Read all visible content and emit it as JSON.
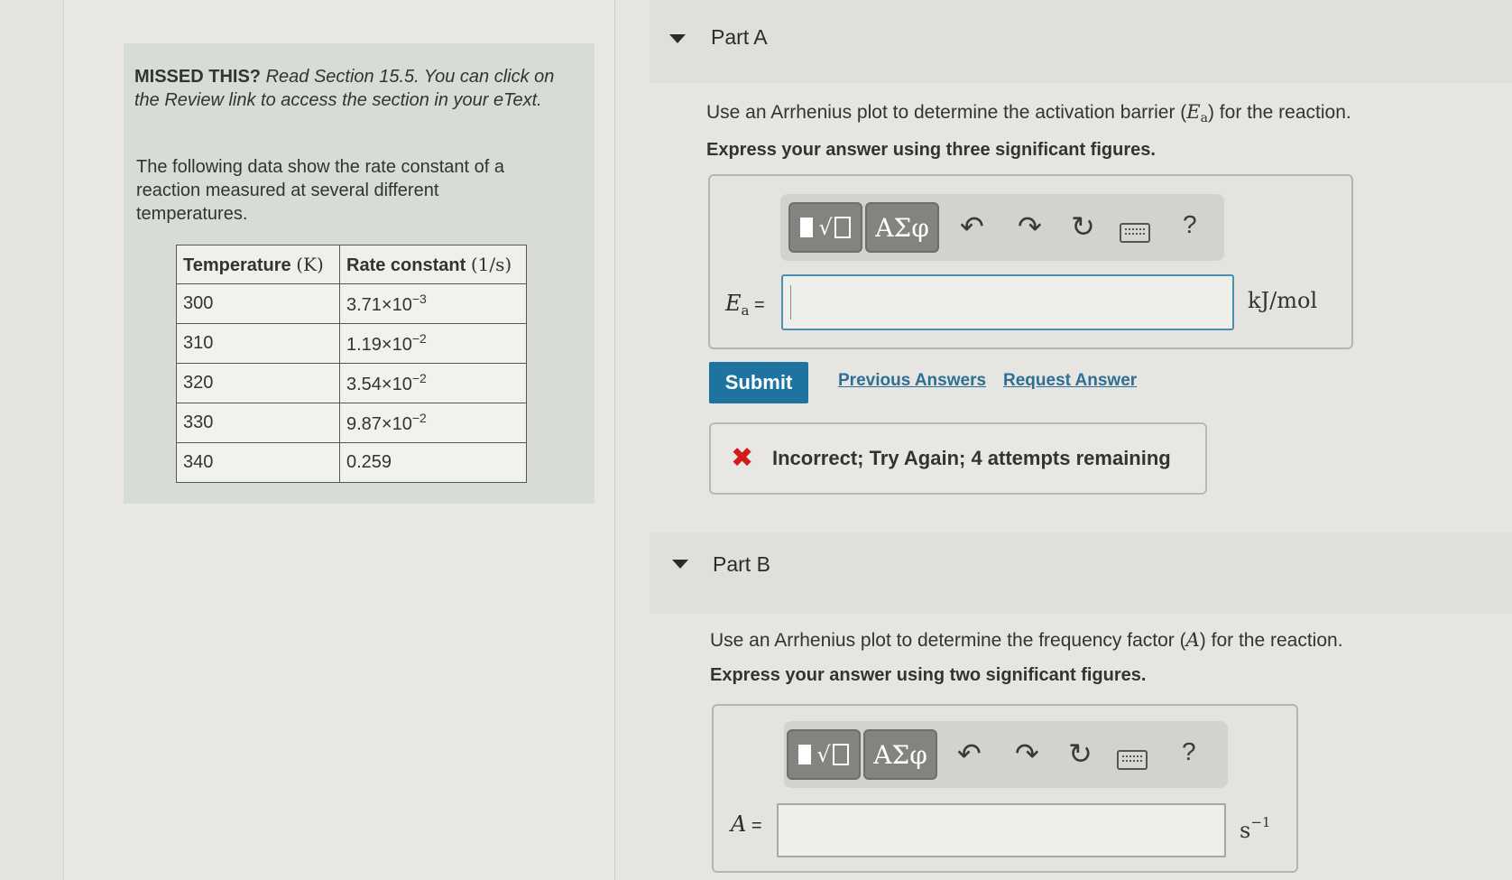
{
  "info": {
    "missed_bold": "MISSED THIS?",
    "missed_text": " Read Section 15.5. You can click on the Review link to access the section in your eText.",
    "lead": "The following data show the rate constant of a reaction measured at several different temperatures.",
    "table": {
      "col1_label": "Temperature",
      "col1_unit": "(K)",
      "col2_label": "Rate constant",
      "col2_unit": "(1/s)",
      "rows": [
        {
          "temp": "300",
          "rate_mant": "3.71×10",
          "rate_exp": "−3"
        },
        {
          "temp": "310",
          "rate_mant": "1.19×10",
          "rate_exp": "−2"
        },
        {
          "temp": "320",
          "rate_mant": "3.54×10",
          "rate_exp": "−2"
        },
        {
          "temp": "330",
          "rate_mant": "9.87×10",
          "rate_exp": "−2"
        },
        {
          "temp": "340",
          "rate_mant": "0.259",
          "rate_exp": ""
        }
      ]
    }
  },
  "partA": {
    "title": "Part A",
    "question_pre": "Use an Arrhenius plot to determine the activation barrier (",
    "question_var": "E",
    "question_sub": "a",
    "question_post": ") for the reaction.",
    "instruction": "Express your answer using three significant figures.",
    "var": "E",
    "var_sub": "a",
    "equals": " =",
    "input_value": "",
    "unit": "kJ/mol",
    "submit_label": "Submit",
    "previous_answers": "Previous Answers",
    "request_answer": "Request Answer",
    "feedback_icon": "✖",
    "feedback_text": "Incorrect; Try Again; 4 attempts remaining"
  },
  "partB": {
    "title": "Part B",
    "question_pre": "Use an Arrhenius plot to determine the frequency factor (",
    "question_var": "A",
    "question_post": ") for the reaction.",
    "instruction": "Express your answer using two significant figures.",
    "var": "A",
    "equals": " =",
    "input_value": "",
    "unit_base": "s",
    "unit_exp": "−1"
  },
  "toolbar": {
    "greek_label": "ΑΣφ",
    "radical_glyph": "√",
    "undo_glyph": "↶",
    "redo_glyph": "↷",
    "reset_glyph": "↻",
    "help_label": "?"
  },
  "colors": {
    "submit": "#1e73a1",
    "error": "#d21b1b",
    "input_border_active": "#4d8fb0"
  }
}
